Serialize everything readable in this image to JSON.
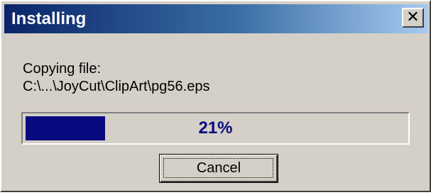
{
  "window": {
    "title": "Installing",
    "close_glyph": "✕",
    "title_gradient": [
      "#0a246a",
      "#a6caf0"
    ],
    "face_color": "#d4d0c8"
  },
  "status": {
    "line1": "Copying file:",
    "line2": "C:\\...\\JoyCut\\ClipArt\\pg56.eps"
  },
  "progress": {
    "percent": 21,
    "label": "21%",
    "fill_color": "#0a0a80"
  },
  "buttons": {
    "cancel_label": "Cancel"
  },
  "icons": {
    "close": "close-icon"
  }
}
